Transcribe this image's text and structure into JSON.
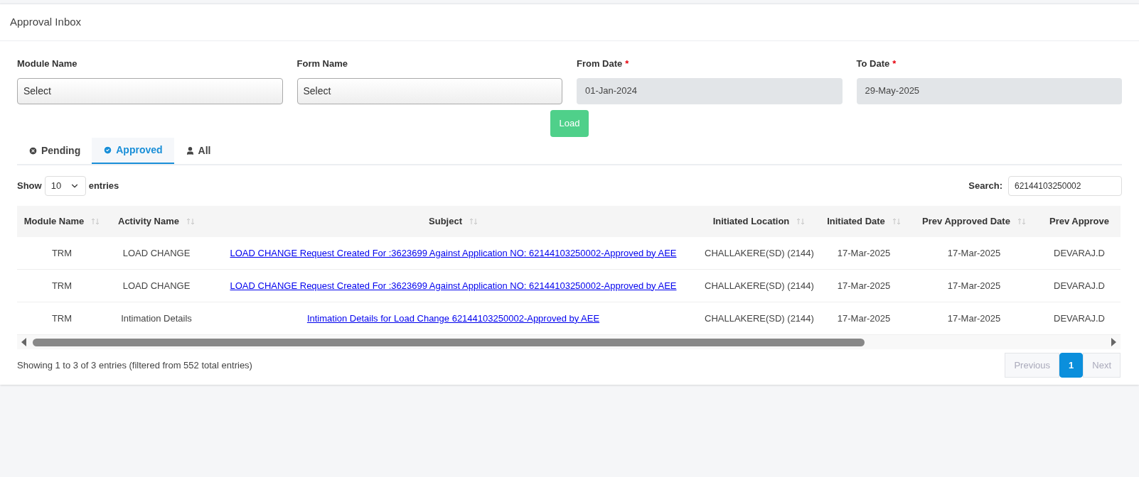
{
  "panel": {
    "title": "Approval Inbox"
  },
  "filters": [
    {
      "kind": "select",
      "label": "Module Name",
      "required": false,
      "value": "Select"
    },
    {
      "kind": "select",
      "label": "Form Name",
      "required": false,
      "value": "Select"
    },
    {
      "kind": "date",
      "label": "From Date",
      "required": true,
      "value": "01-Jan-2024"
    },
    {
      "kind": "date",
      "label": "To Date",
      "required": true,
      "value": "29-May-2025"
    }
  ],
  "required_mark": "*",
  "load_button": "Load",
  "tabs": [
    {
      "label": "Pending",
      "kind": "pending",
      "selected": false
    },
    {
      "label": "Approved",
      "kind": "approved",
      "selected": true
    },
    {
      "label": "All",
      "kind": "all",
      "selected": false
    }
  ],
  "length_control": {
    "before": "Show",
    "value": "10",
    "after": "entries"
  },
  "search": {
    "label": "Search:",
    "value": "62144103250002"
  },
  "table": {
    "columns": [
      {
        "label": "Module Name",
        "sortable": true,
        "kind": "text"
      },
      {
        "label": "Activity Name",
        "sortable": true,
        "kind": "text"
      },
      {
        "label": "Subject",
        "sortable": true,
        "kind": "link"
      },
      {
        "label": "Initiated Location",
        "sortable": true,
        "kind": "text"
      },
      {
        "label": "Initiated Date",
        "sortable": true,
        "kind": "text"
      },
      {
        "label": "Prev Approved Date",
        "sortable": true,
        "kind": "text"
      },
      {
        "label": "Prev Approve",
        "sortable": false,
        "kind": "text"
      }
    ],
    "rows": [
      [
        "TRM",
        "LOAD CHANGE",
        "LOAD CHANGE Request Created For :3623699 Against Application NO: 62144103250002-Approved by AEE",
        "CHALLAKERE(SD) (2144)",
        "17-Mar-2025",
        "17-Mar-2025",
        "DEVARAJ.D"
      ],
      [
        "TRM",
        "LOAD CHANGE",
        "LOAD CHANGE Request Created For :3623699 Against Application NO: 62144103250002-Approved by AEE",
        "CHALLAKERE(SD) (2144)",
        "17-Mar-2025",
        "17-Mar-2025",
        "DEVARAJ.D"
      ],
      [
        "TRM",
        "Intimation Details",
        "Intimation Details for Load Change 62144103250002-Approved by AEE",
        "CHALLAKERE(SD) (2144)",
        "17-Mar-2025",
        "17-Mar-2025",
        "DEVARAJ.D"
      ]
    ]
  },
  "info": "Showing 1 to 3 of 3 entries (filtered from 552 total entries)",
  "pagination": [
    {
      "label": "Previous",
      "selected": false,
      "disabled": true
    },
    {
      "label": "1",
      "selected": true,
      "disabled": false
    },
    {
      "label": "Next",
      "selected": false,
      "disabled": true
    }
  ]
}
